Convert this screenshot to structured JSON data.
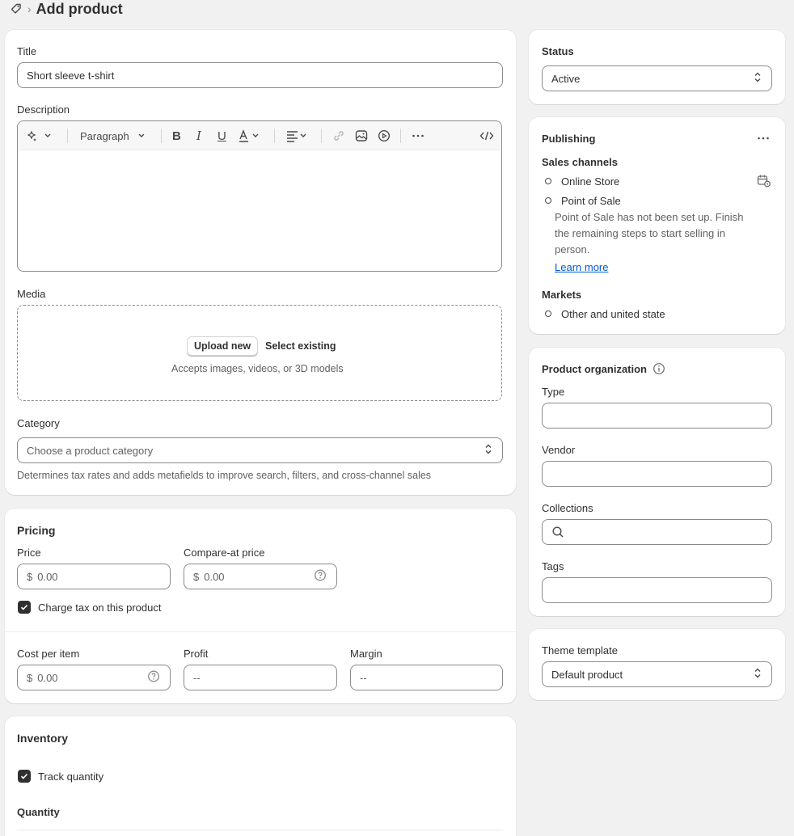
{
  "header": {
    "title": "Add product"
  },
  "main": {
    "title_label": "Title",
    "title_value": "Short sleeve t-shirt",
    "description_label": "Description",
    "editor": {
      "paragraph_label": "Paragraph"
    },
    "media_label": "Media",
    "media": {
      "upload_label": "Upload new",
      "select_label": "Select existing",
      "hint": "Accepts images, videos, or 3D models"
    },
    "category_label": "Category",
    "category_placeholder": "Choose a product category",
    "category_help": "Determines tax rates and adds metafields to improve search, filters, and cross-channel sales"
  },
  "pricing": {
    "heading": "Pricing",
    "price_label": "Price",
    "price_currency": "$",
    "price_placeholder": "0.00",
    "compare_label": "Compare-at price",
    "compare_currency": "$",
    "compare_placeholder": "0.00",
    "charge_tax_label": "Charge tax on this product",
    "charge_tax_checked": true,
    "cost_label": "Cost per item",
    "cost_currency": "$",
    "cost_placeholder": "0.00",
    "profit_label": "Profit",
    "profit_value": "--",
    "margin_label": "Margin",
    "margin_value": "--"
  },
  "inventory": {
    "heading": "Inventory",
    "track_label": "Track quantity",
    "track_checked": true,
    "quantity_heading": "Quantity"
  },
  "sidebar": {
    "status_label": "Status",
    "status_value": "Active",
    "publishing": {
      "heading": "Publishing",
      "sales_channels_label": "Sales channels",
      "channels": [
        "Online Store",
        "Point of Sale"
      ],
      "pos_note": [
        "Point of Sale has not been set up. Finish",
        "the remaining steps to start selling in",
        "person."
      ],
      "learn_more": "Learn more",
      "markets_label": "Markets",
      "markets": [
        "Other and united state"
      ]
    },
    "organization": {
      "heading": "Product organization",
      "type_label": "Type",
      "vendor_label": "Vendor",
      "collections_label": "Collections",
      "tags_label": "Tags"
    },
    "theme": {
      "label": "Theme template",
      "value": "Default product"
    }
  },
  "colors": {
    "link": "#005bd3",
    "text": "#303030",
    "subdued": "#616161",
    "background": "#f1f1f1"
  }
}
